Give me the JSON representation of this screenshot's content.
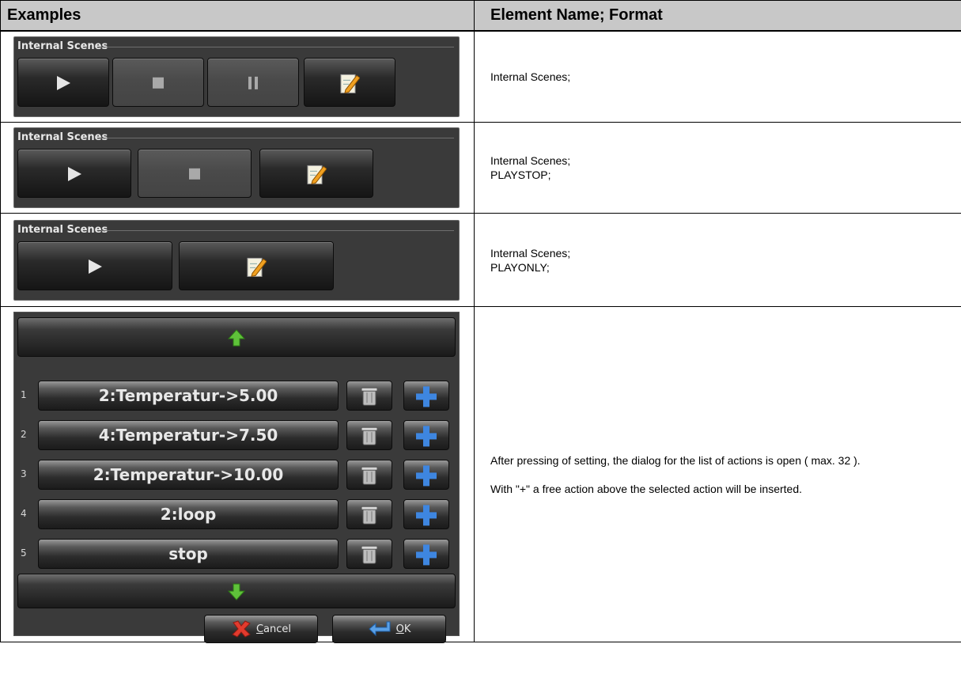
{
  "header": {
    "examples_label": "Examples",
    "format_label": "Element Name; Format"
  },
  "rows": [
    {
      "widget_title": "Internal Scenes",
      "buttons": [
        "play-icon",
        "stop-icon",
        "pause-icon",
        "edit-icon"
      ],
      "lines": [
        "Internal Scenes;"
      ]
    },
    {
      "widget_title": "Internal Scenes",
      "buttons": [
        "play-icon",
        "stop-icon",
        "edit-icon"
      ],
      "lines": [
        "Internal Scenes;",
        "PLAYSTOP;"
      ]
    },
    {
      "widget_title": "Internal Scenes",
      "buttons": [
        "play-icon",
        "edit-icon"
      ],
      "lines": [
        "Internal Scenes;",
        "PLAYONLY;"
      ]
    }
  ],
  "dialog": {
    "actions": [
      {
        "num": "1",
        "label": "2:Temperatur->5.00"
      },
      {
        "num": "2",
        "label": "4:Temperatur->7.50"
      },
      {
        "num": "3",
        "label": "2:Temperatur->10.00"
      },
      {
        "num": "4",
        "label": "2:loop"
      },
      {
        "num": "5",
        "label": "stop"
      }
    ],
    "cancel_prefix": "C",
    "cancel_rest": "ancel",
    "ok_prefix": "O",
    "ok_rest": "K",
    "icons": {
      "up": "arrow-up-icon",
      "down": "arrow-down-icon",
      "delete": "trash-icon",
      "add": "plus-icon"
    },
    "colors": {
      "arrow": "#5fc23a",
      "plus": "#3e86e0"
    }
  },
  "description": {
    "para1": "After pressing of setting, the dialog for the list of actions is open ( max. 32 ).",
    "para2": "With \"+\" a free action above the selected action will be inserted."
  }
}
